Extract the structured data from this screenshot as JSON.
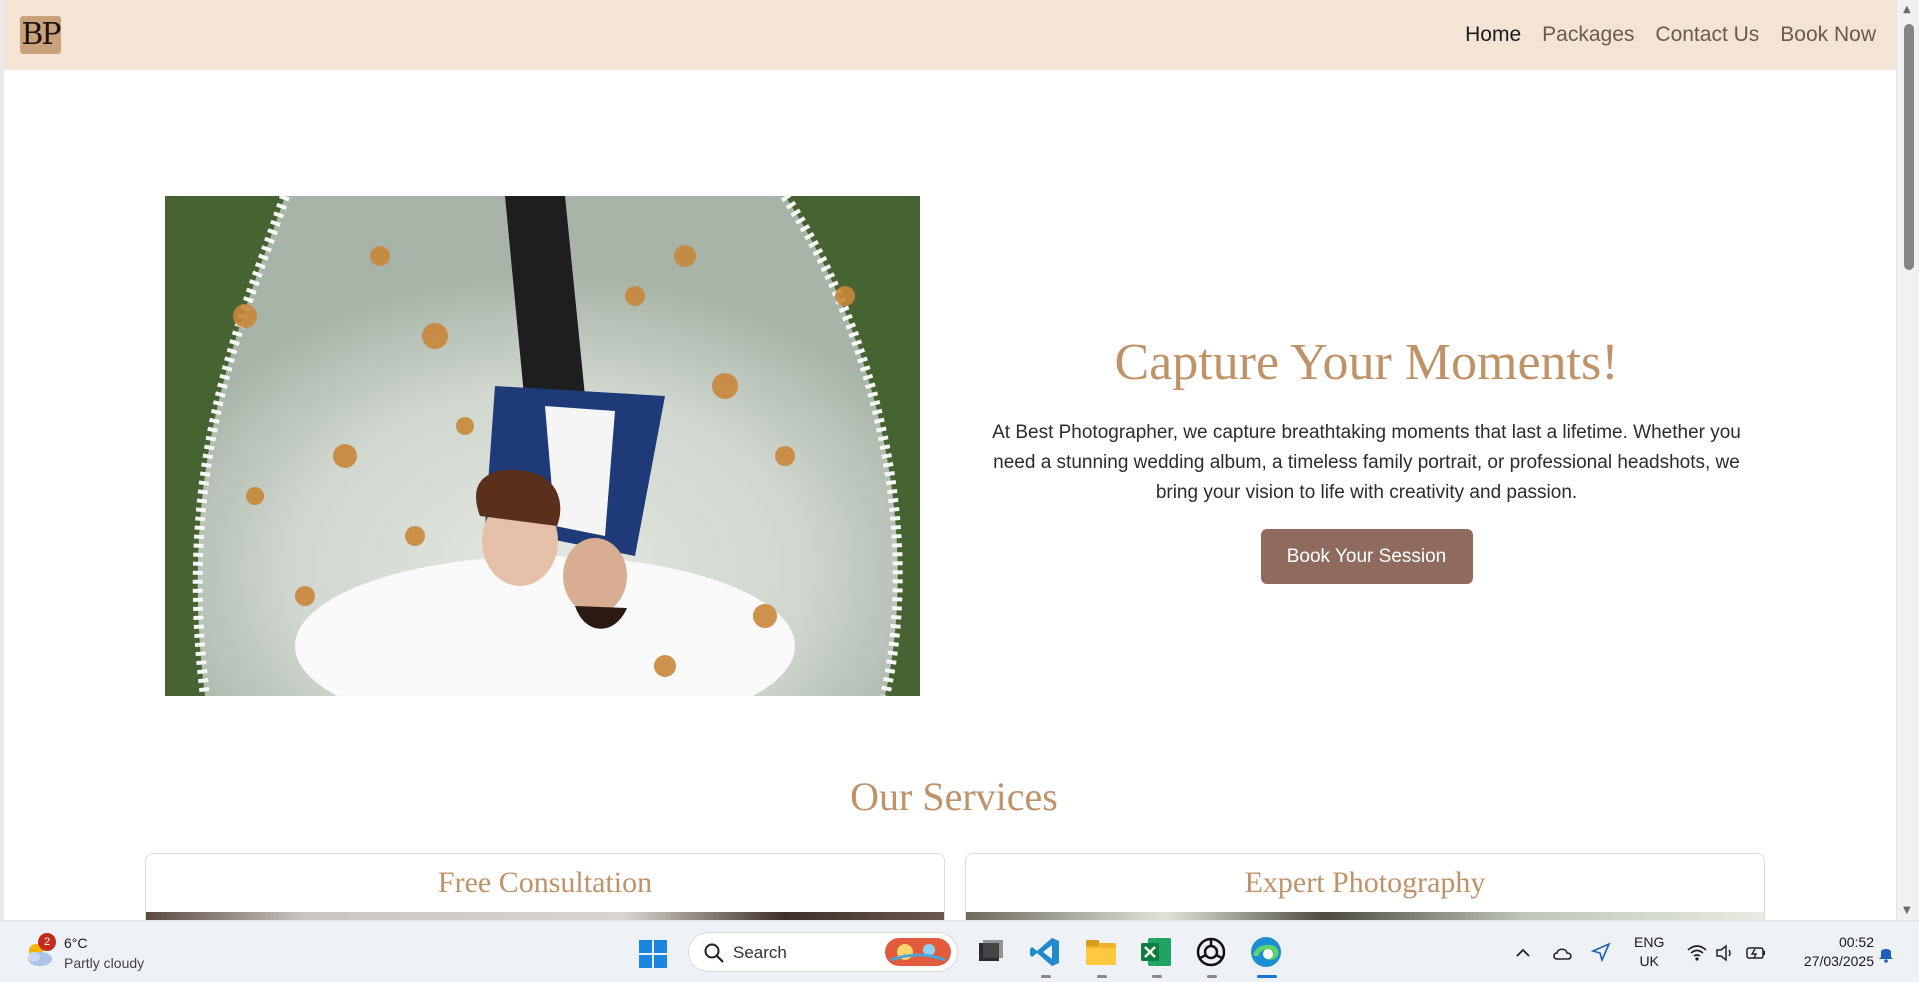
{
  "navbar": {
    "logo_text": "BP",
    "links": [
      {
        "label": "Home",
        "active": true
      },
      {
        "label": "Packages",
        "active": false
      },
      {
        "label": "Contact Us",
        "active": false
      },
      {
        "label": "Book Now",
        "active": false
      }
    ]
  },
  "hero": {
    "title": "Capture Your Moments!",
    "description": "At Best Photographer, we capture breathtaking moments that last a lifetime. Whether you need a stunning wedding album, a timeless family portrait, or professional headshots, we bring your vision to life with creativity and passion.",
    "cta_label": "Book Your Session"
  },
  "services": {
    "title": "Our Services",
    "cards": [
      {
        "title": "Free Consultation"
      },
      {
        "title": "Expert Photography"
      }
    ]
  },
  "taskbar": {
    "weather": {
      "badge": "2",
      "temp": "6°C",
      "condition": "Partly cloudy"
    },
    "search_label": "Search",
    "language": {
      "line1": "ENG",
      "line2": "UK"
    },
    "clock": {
      "time": "00:52",
      "date": "27/03/2025"
    }
  },
  "colors": {
    "navbar_bg": "#f3e4d6",
    "accent_gold": "#c09268",
    "cta_bg": "#8f6b5e"
  }
}
